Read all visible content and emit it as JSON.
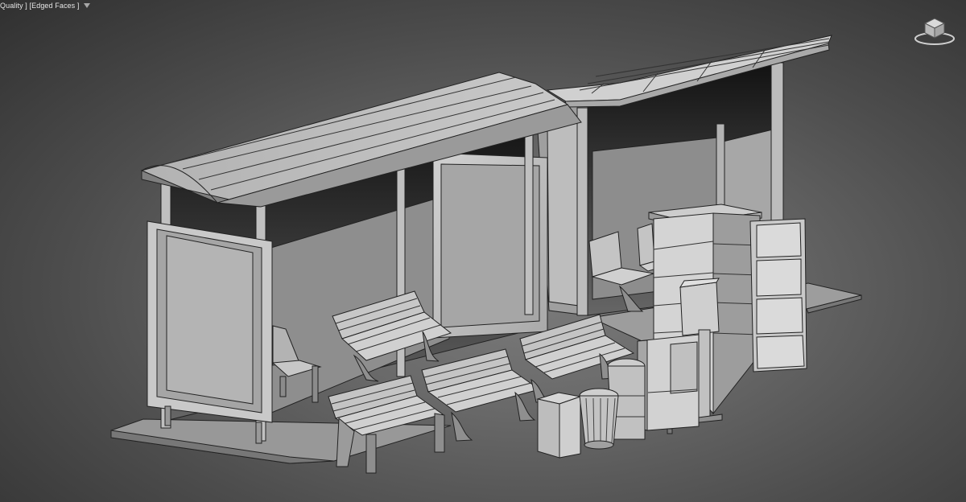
{
  "viewport": {
    "label": "Quality ] [Edged Faces ]",
    "menu_icon": "filter-triangle-icon",
    "viewcube_icon": "viewcube-icon"
  },
  "colors": {
    "viewport_center": "#7b7b7b",
    "viewport_edge": "#303030",
    "model_light": "#c9c9c9",
    "model_mid": "#a7a7a7",
    "model_dark": "#6f6f6f",
    "wire": "#262626",
    "shadow": "#1a1a1a"
  }
}
